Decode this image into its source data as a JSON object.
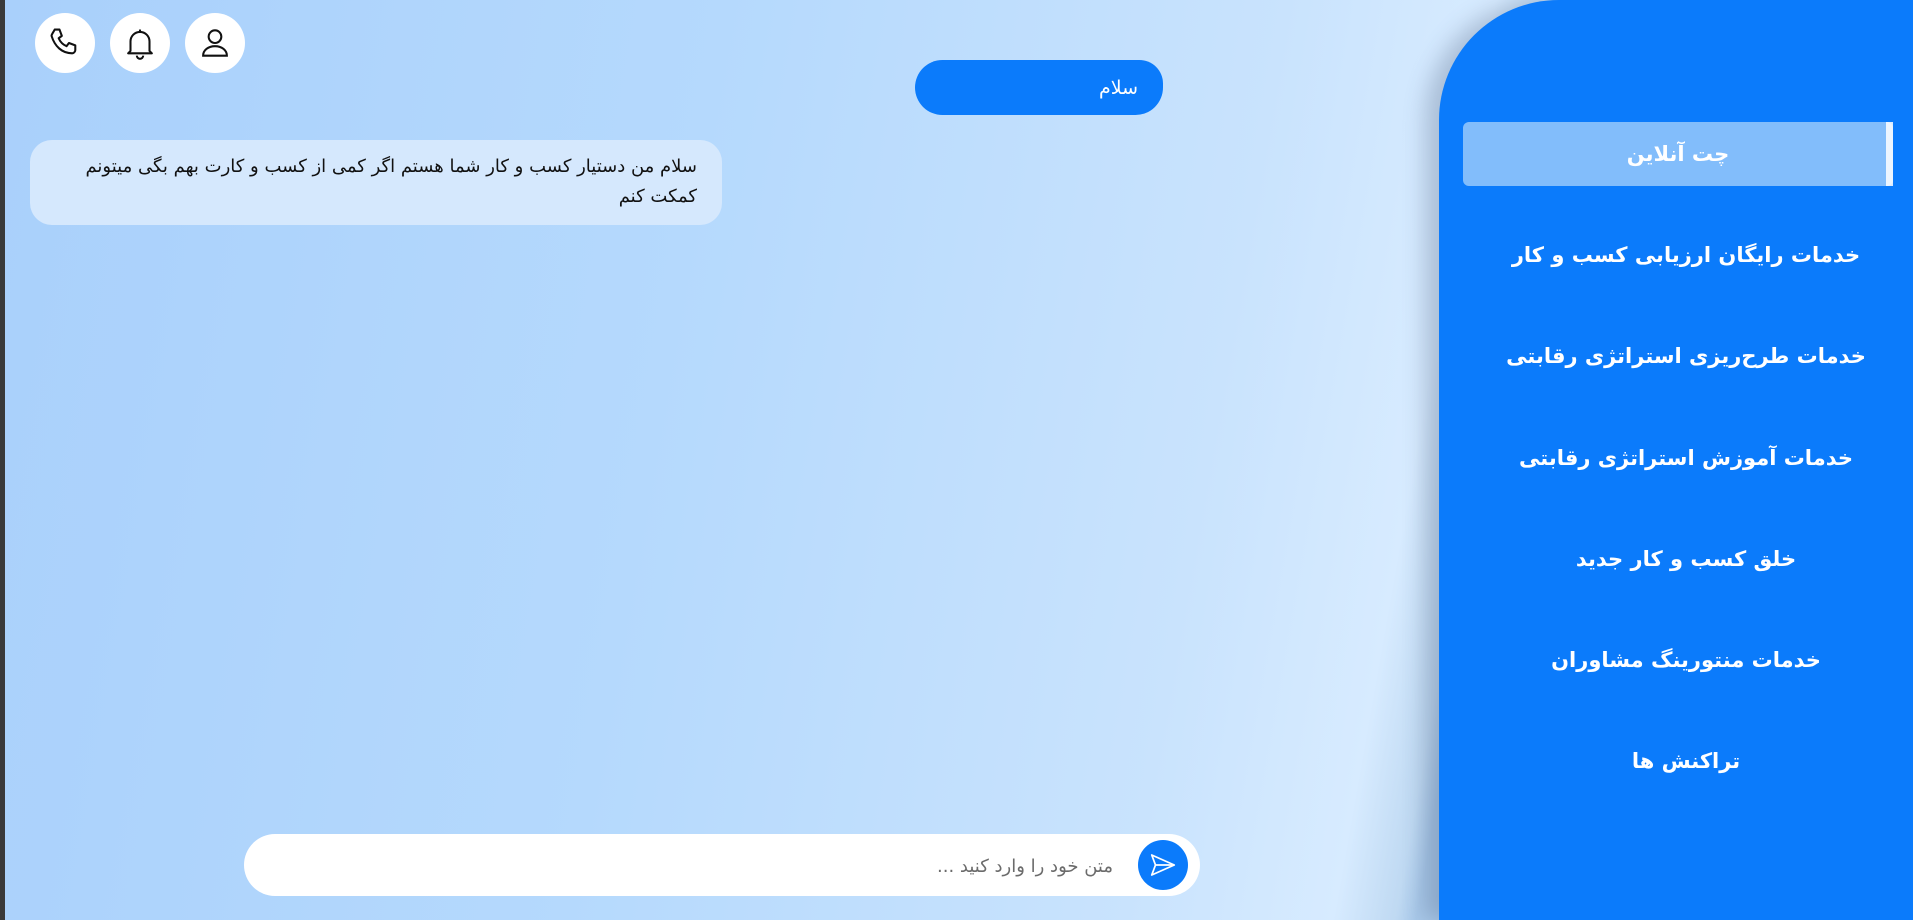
{
  "header": {
    "icons": [
      "phone-icon",
      "bell-icon",
      "user-icon"
    ]
  },
  "chat": {
    "user_message": "سلام",
    "bot_message": "سلام من دستیار کسب و کار شما هستم اگر کمی از کسب و کارت بهم بگی میتونم کمکت کنم",
    "input_placeholder": "متن خود را وارد کنید ...",
    "send_icon": "send-icon"
  },
  "sidebar": {
    "items": [
      {
        "label": "چت آنلاین",
        "active": true
      },
      {
        "label": "خدمات رایگان ارزیابی کسب و کار",
        "active": false
      },
      {
        "label": "خدمات طرح‌ریزی استراتژی رقابتی",
        "active": false
      },
      {
        "label": "خدمات آموزش استراتژی رقابتی",
        "active": false
      },
      {
        "label": "خلق کسب و کار جدید",
        "active": false
      },
      {
        "label": "خدمات منتورینگ مشاوران",
        "active": false
      },
      {
        "label": "تراکنش ها",
        "active": false
      }
    ]
  },
  "colors": {
    "primary": "#0b7bfb",
    "active_item": "#82bdfb",
    "bot_bubble": "#d5e8fd"
  }
}
